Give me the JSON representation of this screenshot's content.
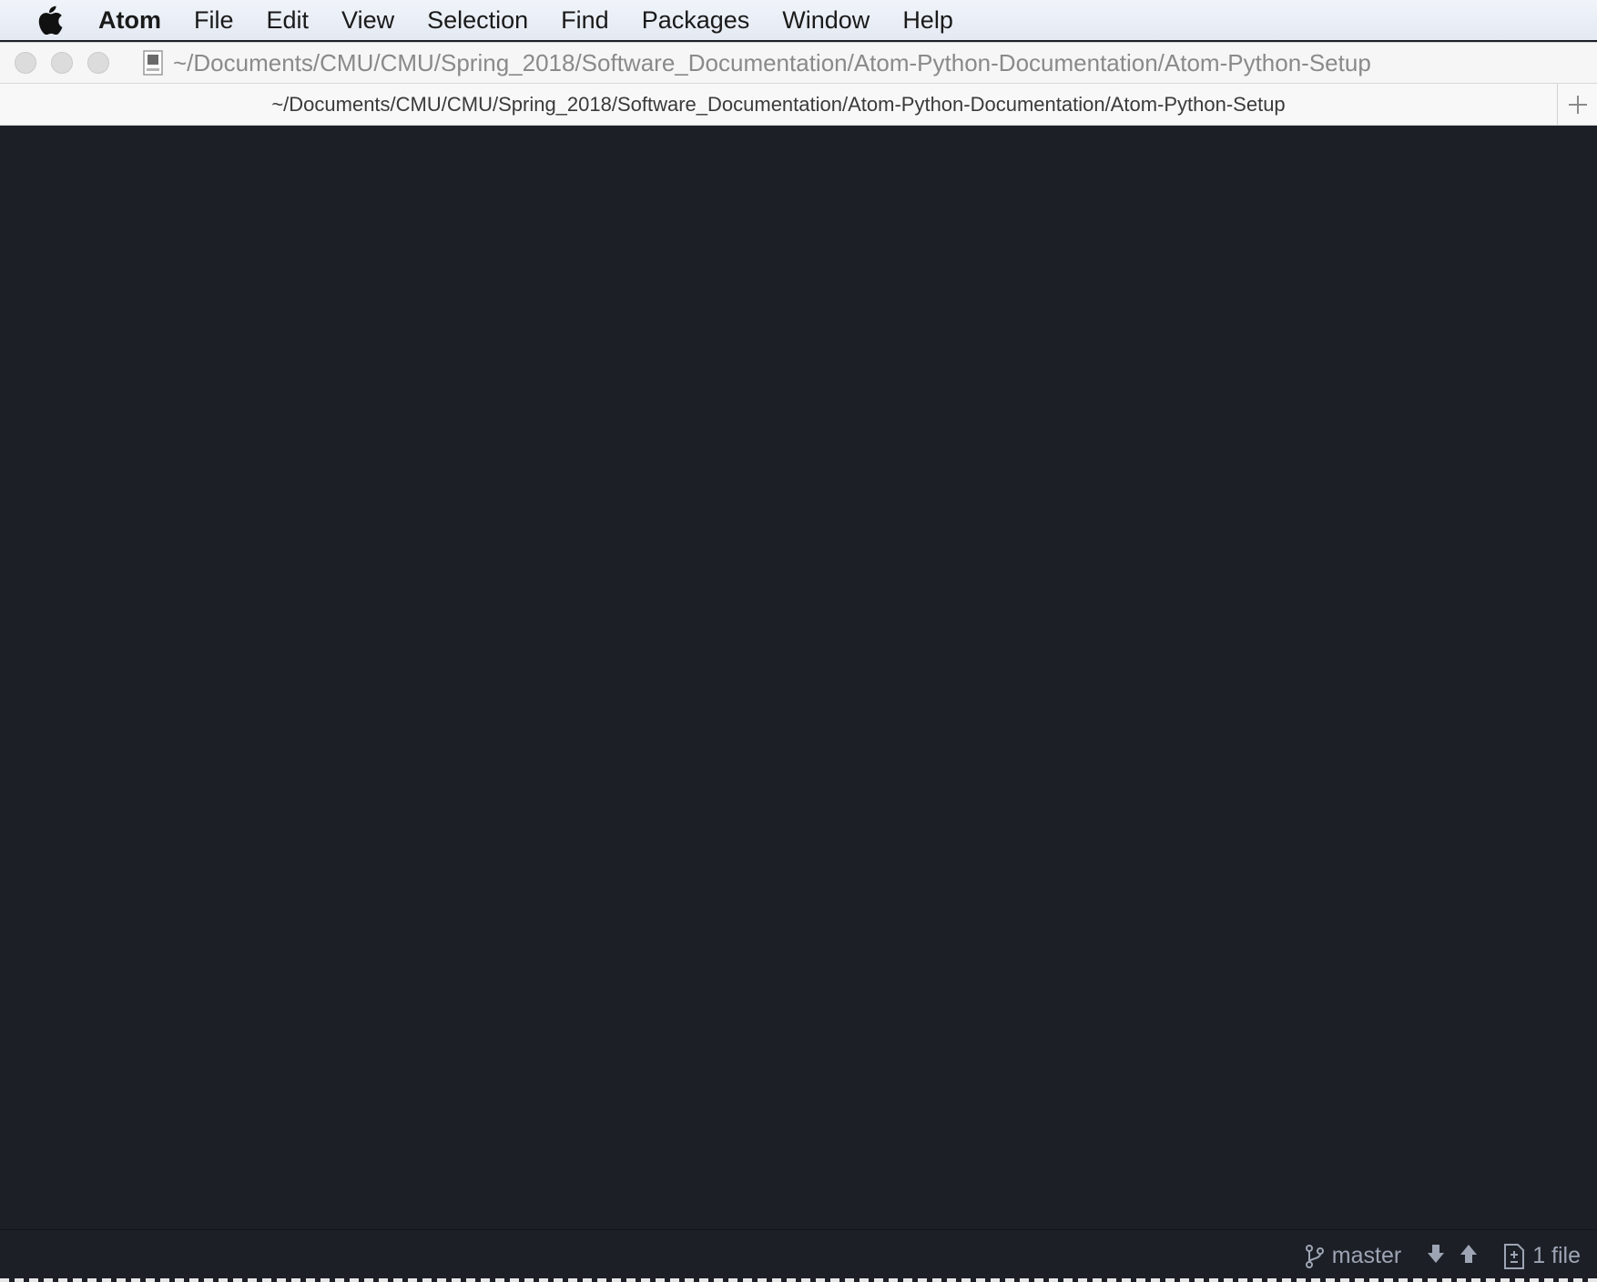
{
  "menubar": {
    "app_name": "Atom",
    "items": [
      "File",
      "Edit",
      "View",
      "Selection",
      "Find",
      "Packages",
      "Window",
      "Help"
    ]
  },
  "window": {
    "title": "~/Documents/CMU/CMU/Spring_2018/Software_Documentation/Atom-Python-Documentation/Atom-Python-Setup"
  },
  "tabs": [
    {
      "label": "~/Documents/CMU/CMU/Spring_2018/Software_Documentation/Atom-Python-Documentation/Atom-Python-Setup"
    }
  ],
  "statusbar": {
    "branch": "master",
    "changed_files": "1 file"
  },
  "colors": {
    "editor_bg": "#1d1f27",
    "status_text": "#9da5b4"
  }
}
